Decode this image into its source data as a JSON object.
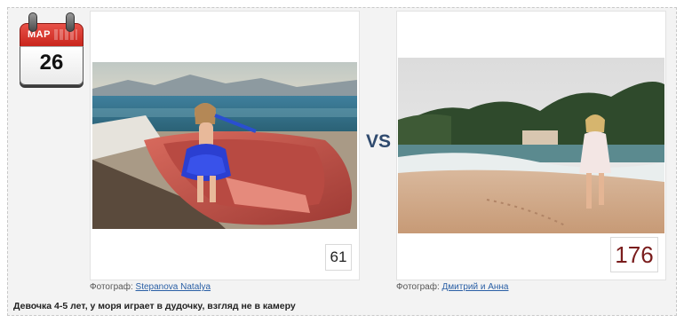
{
  "calendar": {
    "month": "МАР",
    "day": "26",
    "icon": "calendar-icon"
  },
  "left": {
    "votes": "61",
    "credit_label": "Фотограф:",
    "credit_name": "Stepanova Natalya"
  },
  "right": {
    "votes": "176",
    "credit_label": "Фотограф:",
    "credit_name": "Дмитрий и Анна"
  },
  "versus": "VS",
  "caption": "Девочка 4-5 лет, у моря играет в дудочку, взгляд не в камеру",
  "colors": {
    "calendar_red": "#d3342a",
    "vs_blue": "#2f4a6e",
    "link_blue": "#2a5fa5",
    "votes_right": "#7a1d1d",
    "medal_ribbon": "#2f9b8e",
    "medal_silver": "#c9a7ad"
  }
}
